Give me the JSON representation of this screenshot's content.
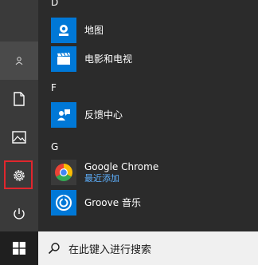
{
  "sections": [
    {
      "letter": "D",
      "apps": [
        {
          "name": "地图",
          "icon": "maps-icon"
        },
        {
          "name": "电影和电视",
          "icon": "movies-tv-icon"
        }
      ]
    },
    {
      "letter": "F",
      "apps": [
        {
          "name": "反馈中心",
          "icon": "feedback-hub-icon"
        }
      ]
    },
    {
      "letter": "G",
      "apps": [
        {
          "name": "Google Chrome",
          "sub": "最近添加",
          "icon": "chrome-icon"
        },
        {
          "name": "Groove 音乐",
          "icon": "groove-music-icon"
        }
      ]
    }
  ],
  "rail": [
    "user-icon",
    "documents-icon",
    "pictures-icon",
    "settings-icon",
    "power-icon"
  ],
  "search": {
    "placeholder": "在此键入进行搜索"
  },
  "colors": {
    "accent": "#0078d7",
    "highlight": "#e0262d",
    "recently_added": "#5eb1ff"
  }
}
